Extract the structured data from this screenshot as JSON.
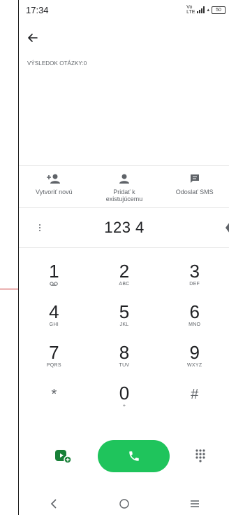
{
  "status_bar": {
    "time": "17:34",
    "network_top": "Vo",
    "network_bottom": "LTE",
    "battery": "50"
  },
  "header": {
    "back_icon": "arrow-left-icon"
  },
  "results": {
    "label": "VÝSLEDOK OTÁZKY:0"
  },
  "actions": [
    {
      "label": "Vytvoriť novú",
      "icon": "add-contact-icon"
    },
    {
      "label": "Pridať k existujúcemu",
      "icon": "person-icon"
    },
    {
      "label": "Odoslať SMS",
      "icon": "message-icon"
    }
  ],
  "dialer": {
    "number": "123 4"
  },
  "keypad": [
    [
      {
        "digit": "1",
        "letters": ""
      },
      {
        "digit": "2",
        "letters": "ABC"
      },
      {
        "digit": "3",
        "letters": "DEF"
      }
    ],
    [
      {
        "digit": "4",
        "letters": "GHI"
      },
      {
        "digit": "5",
        "letters": "JKL"
      },
      {
        "digit": "6",
        "letters": "MNO"
      }
    ],
    [
      {
        "digit": "7",
        "letters": "PQRS"
      },
      {
        "digit": "8",
        "letters": "TUV"
      },
      {
        "digit": "9",
        "letters": "WXYZ"
      }
    ],
    [
      {
        "digit": "*",
        "letters": ""
      },
      {
        "digit": "0",
        "letters": "+"
      },
      {
        "digit": "#",
        "letters": ""
      }
    ]
  ],
  "colors": {
    "accent_green": "#1fc45c",
    "video_green": "#188038",
    "annotation_red": "#c62828"
  },
  "icons": {
    "video": "video-call-icon",
    "call": "phone-icon",
    "dialpad": "dialpad-icon",
    "nav_back": "nav-back-icon",
    "nav_home": "nav-home-icon",
    "nav_recents": "nav-recents-icon",
    "voicemail": "voicemail-icon",
    "more": "more-vert-icon",
    "backspace": "backspace-icon"
  }
}
